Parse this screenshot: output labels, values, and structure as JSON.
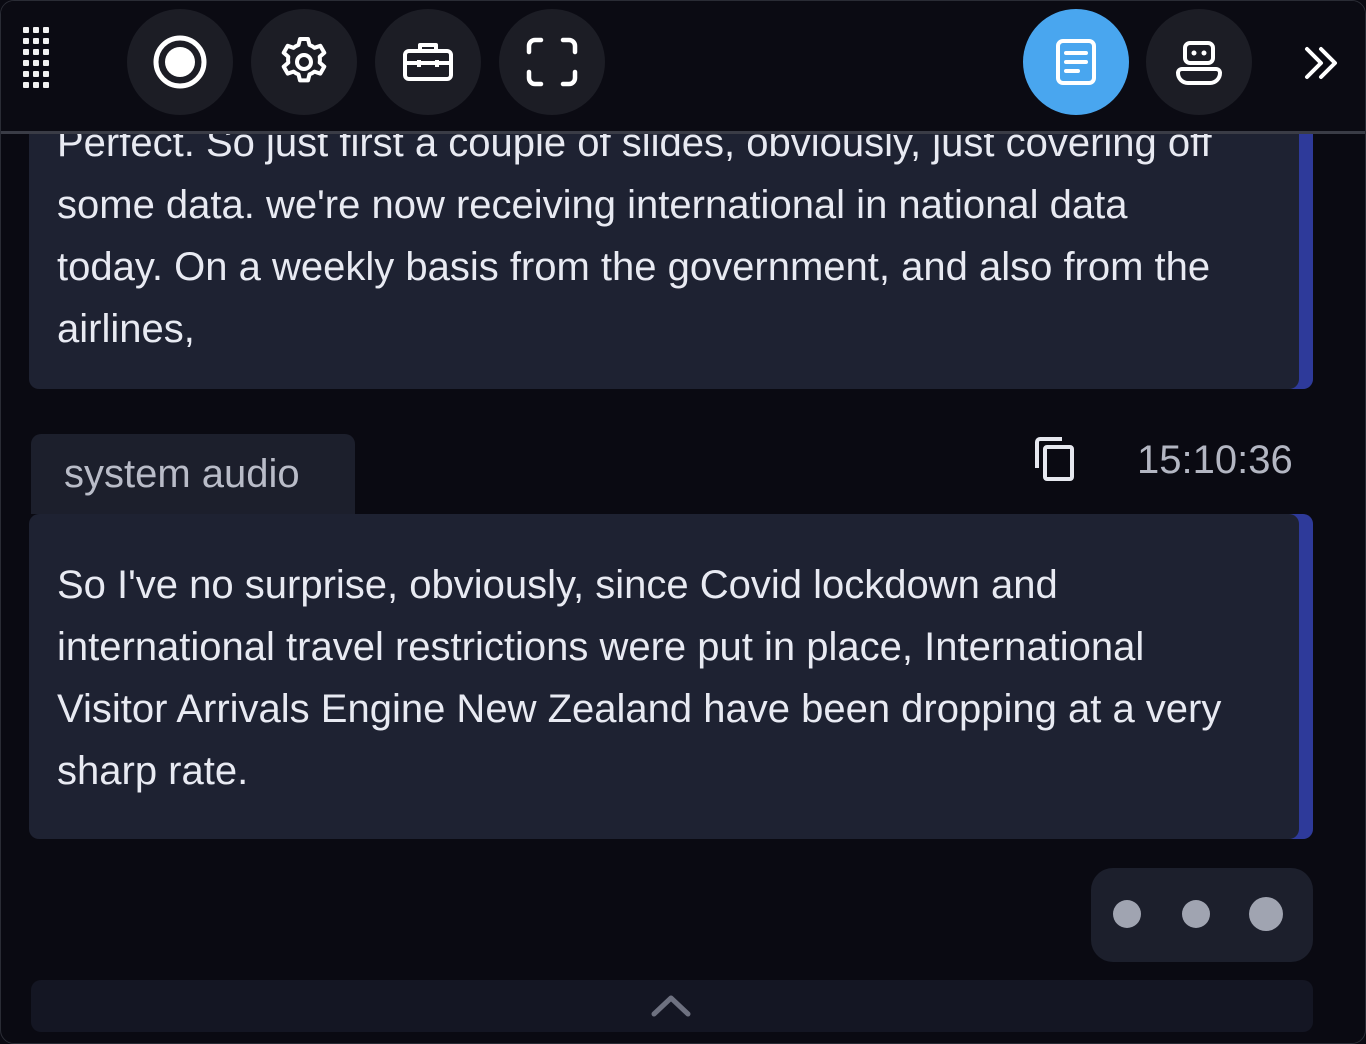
{
  "toolbar": {
    "buttons": [
      {
        "name": "record-icon"
      },
      {
        "name": "gear-icon"
      },
      {
        "name": "toolbox-icon"
      },
      {
        "name": "fullscreen-icon"
      },
      {
        "name": "transcript-icon",
        "active": true
      },
      {
        "name": "robot-icon"
      }
    ],
    "expand_icon": "double-chevron-right-icon",
    "accent_color": "#49a6ef"
  },
  "messages": [
    {
      "source": "",
      "text": "Perfect. So just first a couple of slides, obviously, just covering off some data. we're now receiving international in national data today. On a weekly basis from the government, and also from the airlines,"
    },
    {
      "source": "system audio",
      "time": "15:10:36",
      "text": "So I've no surprise, obviously, since Covid lockdown and international travel restrictions were put in place, International Visitor Arrivals Engine New Zealand have been dropping at a very sharp rate."
    }
  ],
  "footer": {
    "icon": "chevron-up-icon"
  }
}
